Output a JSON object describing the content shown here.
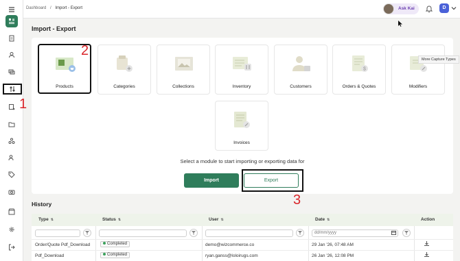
{
  "breadcrumb": {
    "root": "Dashboard",
    "separator": "/",
    "current": "Import - Export"
  },
  "header": {
    "ask_kai_label": "Ask Kai",
    "avatar_letter": "D"
  },
  "page": {
    "title": "Import - Export"
  },
  "modules": [
    {
      "label": "Products",
      "icon": "products-icon"
    },
    {
      "label": "Categories",
      "icon": "categories-icon"
    },
    {
      "label": "Collections",
      "icon": "collections-icon"
    },
    {
      "label": "Inventory",
      "icon": "inventory-icon"
    },
    {
      "label": "Customers",
      "icon": "customers-icon"
    },
    {
      "label": "Orders & Quotes",
      "icon": "orders-quotes-icon"
    },
    {
      "label": "Modifiers",
      "icon": "modifiers-icon"
    },
    {
      "label": "Invoices",
      "icon": "invoices-icon"
    }
  ],
  "tooltip": "More Capture Types",
  "prompt": "Select a module to start importing or exporting data for",
  "buttons": {
    "import": "Import",
    "export": "Export"
  },
  "annotations": {
    "one": "1",
    "two": "2",
    "three": "3"
  },
  "history": {
    "title": "History",
    "columns": {
      "type": "Type",
      "status": "Status",
      "user": "User",
      "date": "Date",
      "action": "Action"
    },
    "date_placeholder": "dd/mm/yyyy",
    "rows": [
      {
        "type": "Order/Quote Pdf_Download",
        "status": "Completed",
        "user": "demo@wizcommerce.co",
        "date": "29 Jan '26, 07:48 AM"
      },
      {
        "type": "Pdf_Download",
        "status": "Completed",
        "user": "ryan.ganss@loloirugs.com",
        "date": "26 Jan '26, 12:08 PM"
      }
    ]
  },
  "colors": {
    "brand_green": "#2f7d5b",
    "annotation_red": "#d9252a",
    "header_bg": "#eef3ea"
  }
}
